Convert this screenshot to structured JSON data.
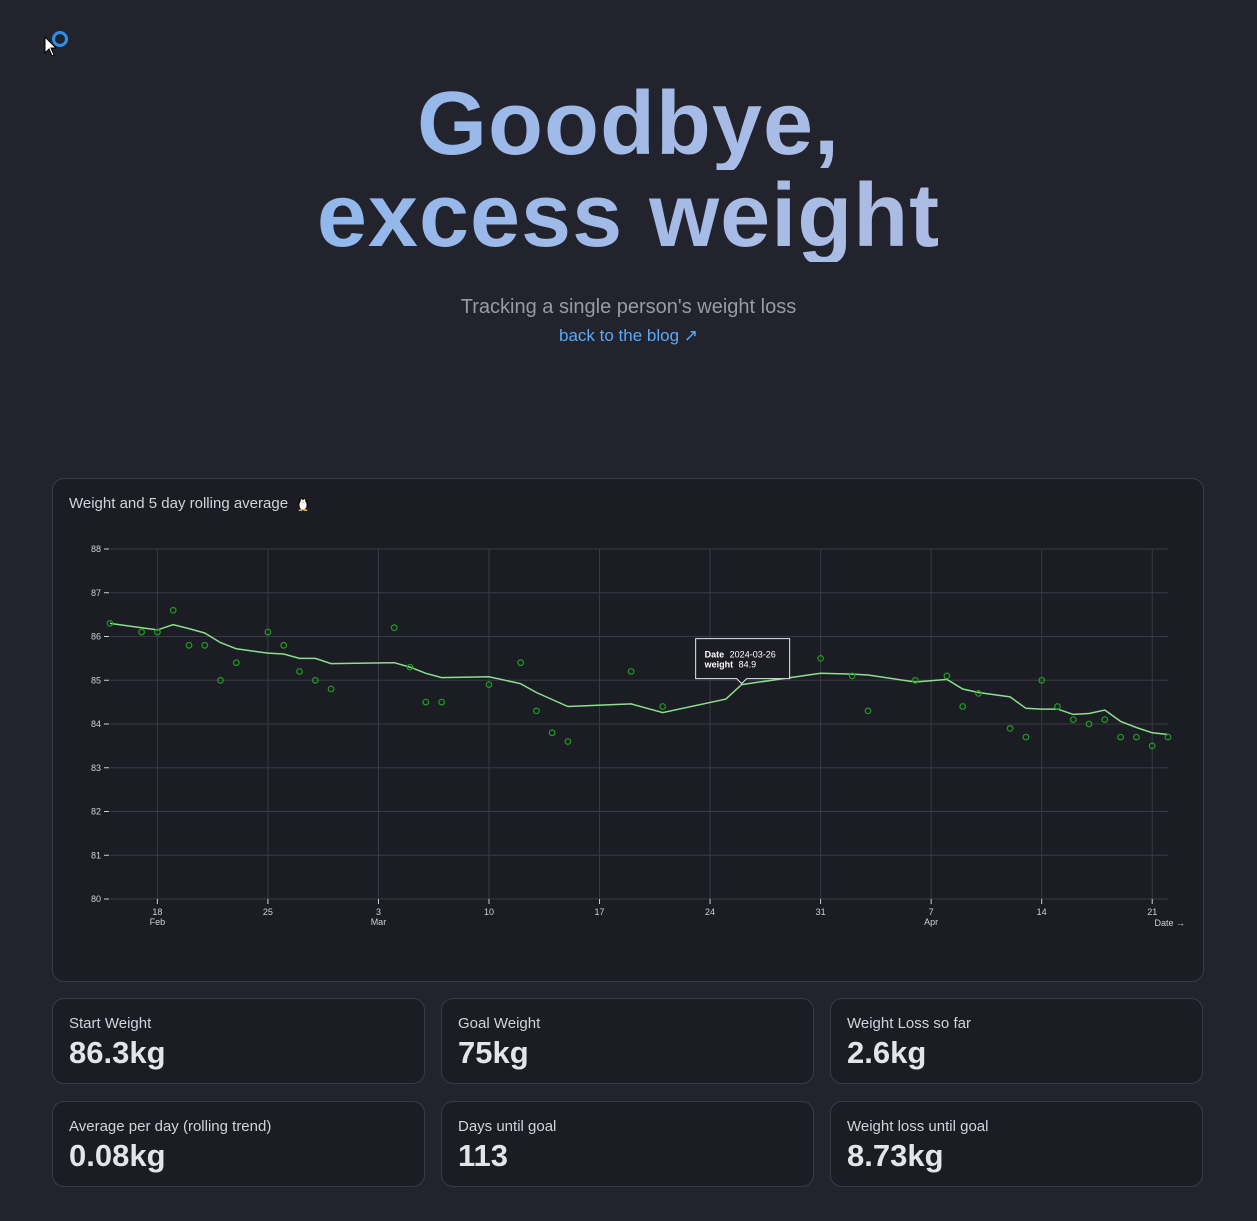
{
  "header": {
    "title_line1": "Goodbye,",
    "title_line2": "excess weight",
    "subtitle": "Tracking a single person's weight loss",
    "blog_link": "back to the blog ↗"
  },
  "chart_card": {
    "title": "Weight and 5 day rolling average",
    "title_icon": "penguin-icon"
  },
  "tooltip": {
    "date_label": "Date",
    "date_value": "2024-03-26",
    "weight_label": "weight",
    "weight_value": "84.9"
  },
  "stats": [
    {
      "label": "Start Weight",
      "value": "86.3kg"
    },
    {
      "label": "Goal Weight",
      "value": "75kg"
    },
    {
      "label": "Weight Loss so far",
      "value": "2.6kg"
    },
    {
      "label": "Average per day (rolling trend)",
      "value": "0.08kg"
    },
    {
      "label": "Days until goal",
      "value": "113"
    },
    {
      "label": "Weight loss until goal",
      "value": "8.73kg"
    }
  ],
  "colors": {
    "accent_link": "#5aa9f5",
    "point_color": "#1e9e1e",
    "line_color": "#8be08b",
    "background": "#23232d",
    "card": "#1c1c24"
  },
  "chart_data": {
    "type": "line",
    "title": "Weight and 5 day rolling average",
    "xlabel": "Date →",
    "ylabel": "",
    "ylim": [
      80,
      88
    ],
    "xlim": [
      "2024-02-15",
      "2024-04-22"
    ],
    "grid": true,
    "y_ticks": [
      80,
      81,
      82,
      83,
      84,
      85,
      86,
      87,
      88
    ],
    "x_ticks": [
      {
        "date": "2024-02-18",
        "label": "18",
        "sub": "Feb"
      },
      {
        "date": "2024-02-25",
        "label": "25",
        "sub": ""
      },
      {
        "date": "2024-03-03",
        "label": "3",
        "sub": "Mar"
      },
      {
        "date": "2024-03-10",
        "label": "10",
        "sub": ""
      },
      {
        "date": "2024-03-17",
        "label": "17",
        "sub": ""
      },
      {
        "date": "2024-03-24",
        "label": "24",
        "sub": ""
      },
      {
        "date": "2024-03-31",
        "label": "31",
        "sub": ""
      },
      {
        "date": "2024-04-07",
        "label": "7",
        "sub": "Apr"
      },
      {
        "date": "2024-04-14",
        "label": "14",
        "sub": ""
      },
      {
        "date": "2024-04-21",
        "label": "21",
        "sub": ""
      }
    ],
    "series": [
      {
        "kind": "scatter",
        "points": [
          [
            "2024-02-15",
            86.3
          ],
          [
            "2024-02-17",
            86.1
          ],
          [
            "2024-02-18",
            86.1
          ],
          [
            "2024-02-19",
            86.6
          ],
          [
            "2024-02-20",
            85.8
          ],
          [
            "2024-02-21",
            85.8
          ],
          [
            "2024-02-22",
            85.0
          ],
          [
            "2024-02-23",
            85.4
          ],
          [
            "2024-02-25",
            86.1
          ],
          [
            "2024-02-26",
            85.8
          ],
          [
            "2024-02-27",
            85.2
          ],
          [
            "2024-02-28",
            85.0
          ],
          [
            "2024-02-29",
            84.8
          ],
          [
            "2024-03-04",
            86.2
          ],
          [
            "2024-03-05",
            85.3
          ],
          [
            "2024-03-06",
            84.5
          ],
          [
            "2024-03-07",
            84.5
          ],
          [
            "2024-03-10",
            84.9
          ],
          [
            "2024-03-12",
            85.4
          ],
          [
            "2024-03-13",
            84.3
          ],
          [
            "2024-03-14",
            83.8
          ],
          [
            "2024-03-15",
            83.6
          ],
          [
            "2024-03-19",
            85.2
          ],
          [
            "2024-03-21",
            84.4
          ],
          [
            "2024-03-31",
            85.5
          ],
          [
            "2024-04-02",
            85.1
          ],
          [
            "2024-04-03",
            84.3
          ],
          [
            "2024-04-06",
            85.0
          ],
          [
            "2024-04-08",
            85.1
          ],
          [
            "2024-04-09",
            84.4
          ],
          [
            "2024-04-10",
            84.7
          ],
          [
            "2024-04-12",
            83.9
          ],
          [
            "2024-04-13",
            83.7
          ],
          [
            "2024-04-14",
            85.0
          ],
          [
            "2024-04-15",
            84.4
          ],
          [
            "2024-04-16",
            84.1
          ],
          [
            "2024-04-17",
            84.0
          ],
          [
            "2024-04-18",
            84.1
          ],
          [
            "2024-04-19",
            83.7
          ],
          [
            "2024-04-20",
            83.7
          ],
          [
            "2024-04-21",
            83.5
          ],
          [
            "2024-04-22",
            83.7
          ]
        ]
      },
      {
        "kind": "line",
        "points": [
          [
            "2024-02-15",
            86.3
          ],
          [
            "2024-02-17",
            86.2
          ],
          [
            "2024-02-18",
            86.15
          ],
          [
            "2024-02-19",
            86.27
          ],
          [
            "2024-02-20",
            86.18
          ],
          [
            "2024-02-21",
            86.08
          ],
          [
            "2024-02-22",
            85.86
          ],
          [
            "2024-02-23",
            85.72
          ],
          [
            "2024-02-25",
            85.62
          ],
          [
            "2024-02-26",
            85.6
          ],
          [
            "2024-02-27",
            85.5
          ],
          [
            "2024-02-28",
            85.5
          ],
          [
            "2024-02-29",
            85.38
          ],
          [
            "2024-03-04",
            85.4
          ],
          [
            "2024-03-05",
            85.3
          ],
          [
            "2024-03-06",
            85.16
          ],
          [
            "2024-03-07",
            85.06
          ],
          [
            "2024-03-10",
            85.08
          ],
          [
            "2024-03-12",
            84.92
          ],
          [
            "2024-03-13",
            84.72
          ],
          [
            "2024-03-14",
            84.56
          ],
          [
            "2024-03-15",
            84.4
          ],
          [
            "2024-03-19",
            84.46
          ],
          [
            "2024-03-21",
            84.26
          ],
          [
            "2024-03-25",
            84.57
          ],
          [
            "2024-03-26",
            84.9
          ],
          [
            "2024-03-31",
            85.16
          ],
          [
            "2024-04-02",
            85.14
          ],
          [
            "2024-04-03",
            85.12
          ],
          [
            "2024-04-06",
            84.96
          ],
          [
            "2024-04-08",
            85.02
          ],
          [
            "2024-04-09",
            84.8
          ],
          [
            "2024-04-10",
            84.72
          ],
          [
            "2024-04-12",
            84.62
          ],
          [
            "2024-04-13",
            84.36
          ],
          [
            "2024-04-14",
            84.34
          ],
          [
            "2024-04-15",
            84.34
          ],
          [
            "2024-04-16",
            84.22
          ],
          [
            "2024-04-17",
            84.24
          ],
          [
            "2024-04-18",
            84.32
          ],
          [
            "2024-04-19",
            84.06
          ],
          [
            "2024-04-20",
            83.92
          ],
          [
            "2024-04-21",
            83.8
          ],
          [
            "2024-04-22",
            83.76
          ]
        ]
      }
    ]
  }
}
